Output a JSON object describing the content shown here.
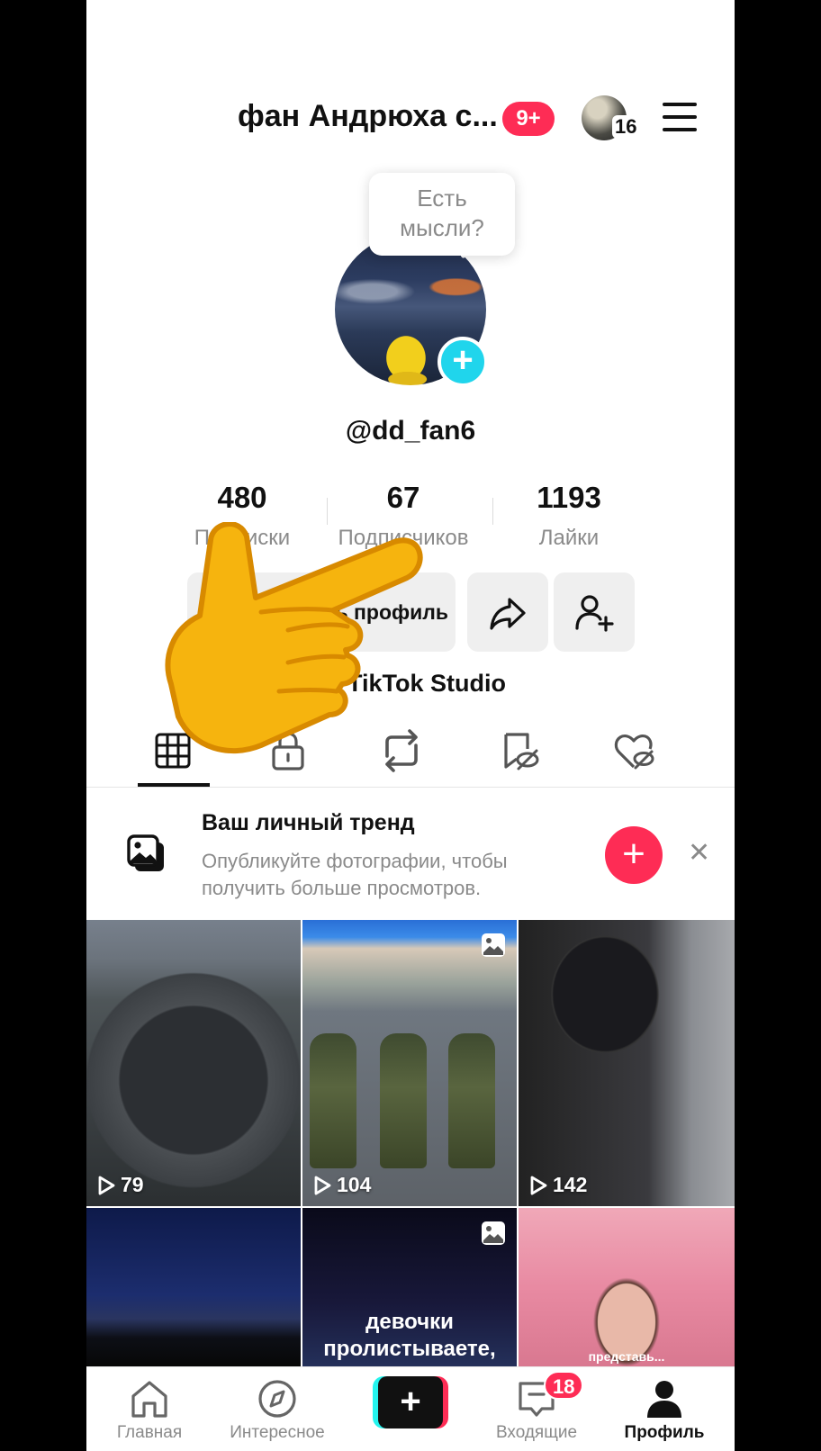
{
  "header": {
    "title": "фан Андрюха с...",
    "notification_badge": "9+",
    "account_count": "16",
    "menu_icon": "hamburger-menu-icon"
  },
  "profile": {
    "note_bubble_line1": "Есть",
    "note_bubble_line2": "мысли?",
    "username": "@dd_fan6",
    "stats": [
      {
        "value": "480",
        "label": "Подписки"
      },
      {
        "value": "67",
        "label": "Подписчиков"
      },
      {
        "value": "1193",
        "label": "Лайки"
      }
    ],
    "edit_button": "Изменить профиль",
    "studio_label": "TikTok Studio"
  },
  "tabs": [
    "videos-grid",
    "private",
    "reposts",
    "favorites",
    "liked"
  ],
  "promo": {
    "title": "Ваш личный тренд",
    "text": "Опубликуйте фотографии, чтобы получить больше просмотров."
  },
  "grid": [
    {
      "views": "79"
    },
    {
      "views": "104"
    },
    {
      "views": "142"
    },
    {
      "views": ""
    },
    {
      "views": "",
      "caption_line1": "девочки",
      "caption_line2": "пролистываете,"
    },
    {
      "views": "",
      "caption": "представь..."
    }
  ],
  "nav": {
    "home": "Главная",
    "explore": "Интересное",
    "inbox": "Входящие",
    "inbox_badge": "18",
    "profile": "Профиль"
  },
  "colors": {
    "accent": "#fe2c55",
    "cyan": "#20d5ec",
    "muted_text": "#8a8a8a"
  }
}
